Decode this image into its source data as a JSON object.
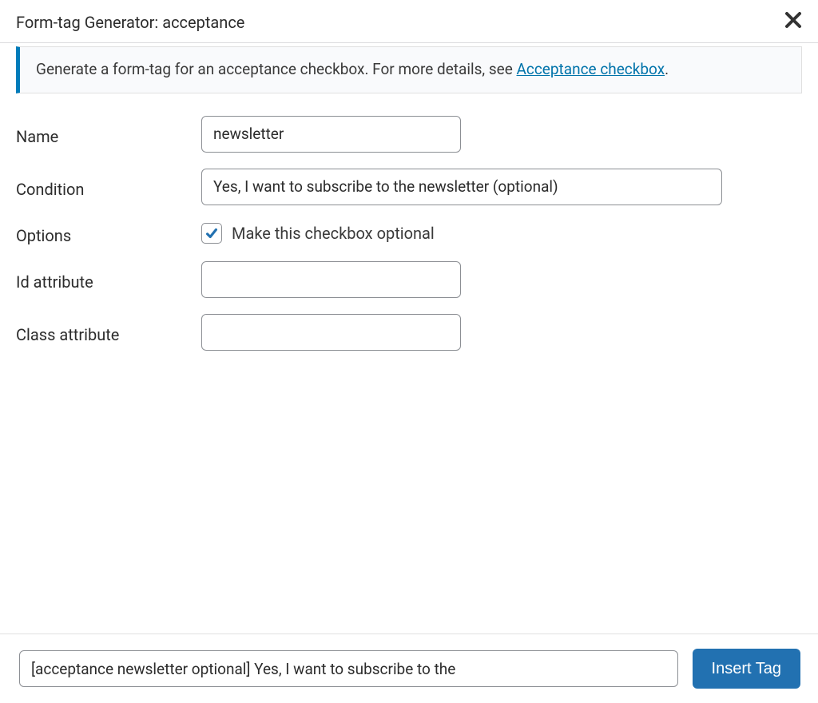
{
  "header": {
    "title": "Form-tag Generator: acceptance"
  },
  "notice": {
    "text_prefix": "Generate a form-tag for an acceptance checkbox. For more details, see ",
    "link_text": "Acceptance checkbox",
    "text_suffix": "."
  },
  "fields": {
    "name": {
      "label": "Name",
      "value": "newsletter"
    },
    "condition": {
      "label": "Condition",
      "value": "Yes, I want to subscribe to the newsletter (optional)"
    },
    "options": {
      "label": "Options",
      "checkbox_label": "Make this checkbox optional",
      "checked": true
    },
    "id_attr": {
      "label": "Id attribute",
      "value": ""
    },
    "class_attr": {
      "label": "Class attribute",
      "value": ""
    }
  },
  "footer": {
    "code": "[acceptance newsletter optional] Yes, I want to subscribe to the",
    "button_label": "Insert Tag"
  }
}
